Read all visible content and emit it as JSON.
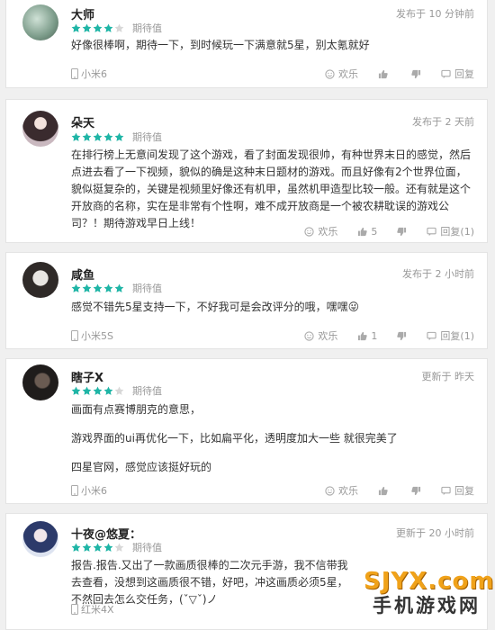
{
  "reviews": [
    {
      "user": "大师",
      "rating": 4,
      "expect_label": "期待值",
      "time": "发布于 10 分钟前",
      "paragraphs": [
        "好像很棒啊，期待一下，到时候玩一下满意就5星，别太氪就好"
      ],
      "device": "小米6",
      "fun_label": "欢乐",
      "like_count": "",
      "reply_label": "回复"
    },
    {
      "user": "朵天",
      "rating": 5,
      "expect_label": "期待值",
      "time": "发布于 2 天前",
      "paragraphs": [
        "在排行榜上无意间发现了这个游戏，看了封面发现很帅，有种世界末日的感觉，然后点进去看了一下视频，貌似的确是这种末日题材的游戏。而且好像有2个世界位面，貌似挺复杂的，关键是视频里好像还有机甲，虽然机甲造型比较一般。还有就是这个开放商的名称，实在是非常有个性啊，难不成开放商是一个被农耕耽误的游戏公司？！期待游戏早日上线！"
      ],
      "device": "",
      "fun_label": "欢乐",
      "like_count": "5",
      "reply_label": "回复(1)"
    },
    {
      "user": "咸鱼",
      "rating": 5,
      "expect_label": "期待值",
      "time": "发布于 2 小时前",
      "paragraphs": [
        "感觉不错先5星支持一下，不好我可是会改评分的哦，嘿嘿😜"
      ],
      "device": "小米5S",
      "fun_label": "欢乐",
      "like_count": "1",
      "reply_label": "回复(1)"
    },
    {
      "user": "瞎子X",
      "rating": 4,
      "expect_label": "期待值",
      "time": "更新于 昨天",
      "paragraphs": [
        "画面有点赛博朋克的意思，",
        "游戏界面的ui再优化一下，比如扁平化，透明度加大一些 就很完美了",
        "四星官网，感觉应该挺好玩的"
      ],
      "device": "小米6",
      "fun_label": "欢乐",
      "like_count": "",
      "reply_label": "回复"
    },
    {
      "user": "十夜@悠夏：",
      "rating": 4,
      "expect_label": "期待值",
      "time": "更新于 20 小时前",
      "paragraphs": [
        "报告.报告.又出了一款画质很棒的二次元手游，我不信带我去查看，没想到这画质很不错，好吧，冲这画质必须5星，不然回去怎么交任务，(ˇ▽ˇ)ノ"
      ],
      "device": "红米4X",
      "fun_label": "",
      "like_count": "",
      "reply_label": ""
    }
  ],
  "watermark": {
    "top": "SJYX.com",
    "bottom": "手机游戏网"
  },
  "colors": {
    "star_on": "#1fb5a6",
    "star_off": "#d8d8d8"
  }
}
